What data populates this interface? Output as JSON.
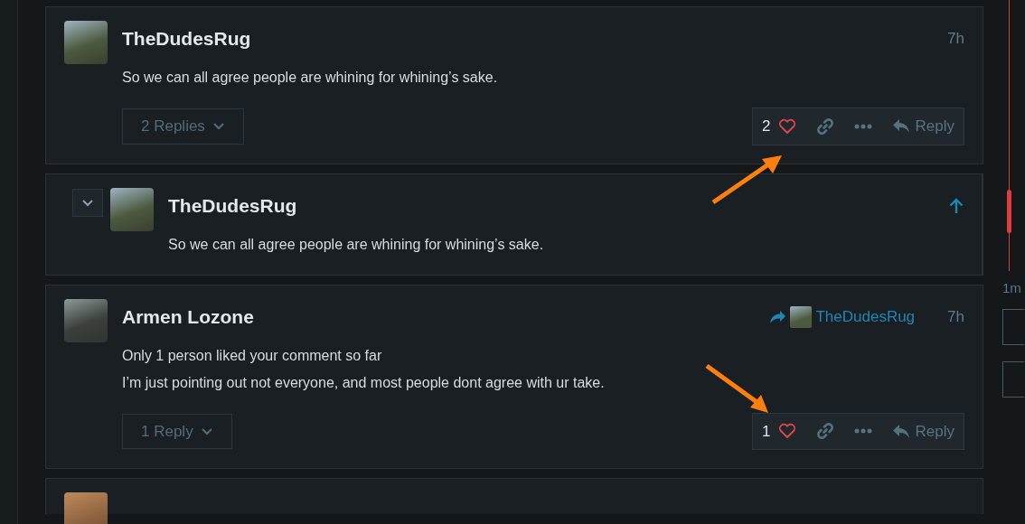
{
  "comments": [
    {
      "kind": "post",
      "author": "TheDudesRug",
      "time": "7h",
      "lines": [
        "So we can all agree people are whining for whining’s sake."
      ],
      "replies_toggle": "2 Replies",
      "likes": "2",
      "reply_label": "Reply",
      "annotation": {
        "kind": "arrow_up"
      }
    },
    {
      "kind": "nested",
      "author": "TheDudesRug",
      "lines": [
        "So we can all agree people are whining for whining’s sake."
      ]
    },
    {
      "kind": "post",
      "author": "Armen Lozone",
      "reply_to": "TheDudesRug",
      "time": "7h",
      "lines": [
        "Only 1 person liked your comment so far",
        "I’m just pointing out not everyone, and most people dont agree with ur take."
      ],
      "replies_toggle": "1 Reply",
      "likes": "1",
      "reply_label": "Reply",
      "annotation": {
        "kind": "arrow_down"
      }
    },
    {
      "kind": "partial"
    }
  ],
  "timeline": {
    "label": "1m"
  }
}
